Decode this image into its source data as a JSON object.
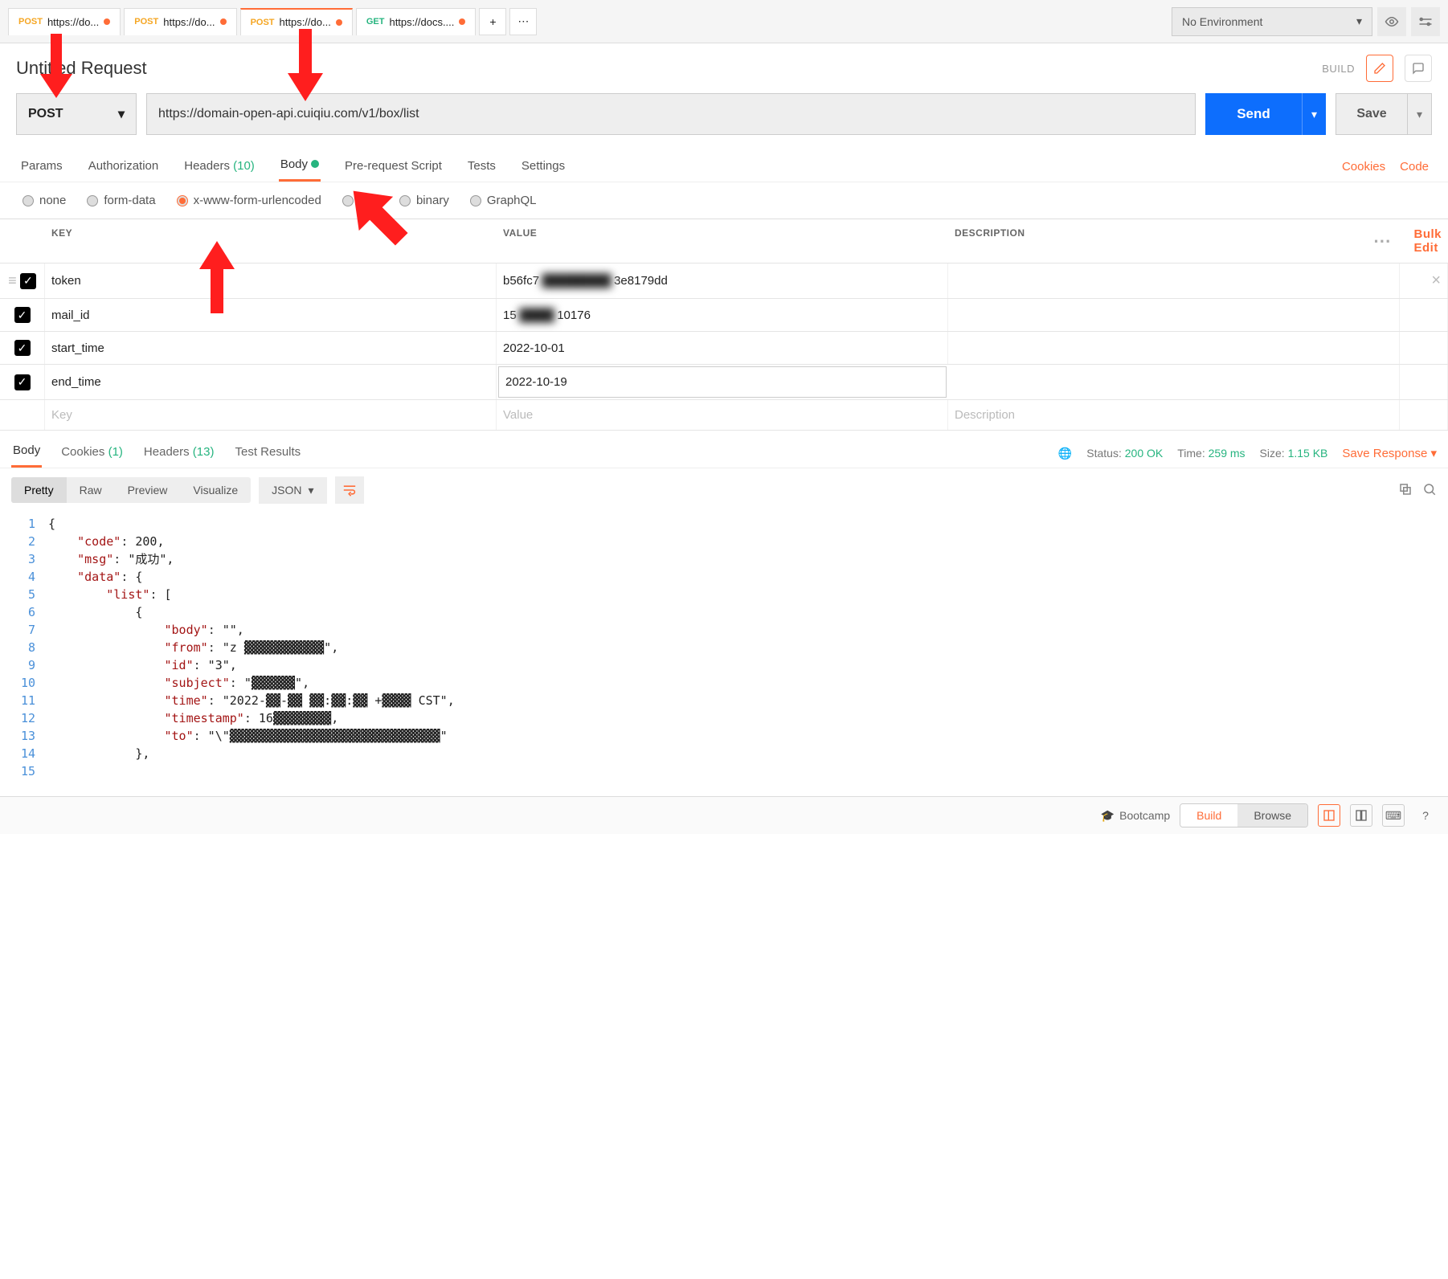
{
  "topbar": {
    "tabs": [
      {
        "method": "POST",
        "label": "https://do...",
        "method_class": "method-post"
      },
      {
        "method": "POST",
        "label": "https://do...",
        "method_class": "method-post"
      },
      {
        "method": "POST",
        "label": "https://do...",
        "method_class": "method-post",
        "active": true
      },
      {
        "method": "GET",
        "label": "https://docs....",
        "method_class": "method-get"
      }
    ],
    "env_label": "No Environment"
  },
  "request": {
    "title": "Untitled Request",
    "build_label": "BUILD",
    "method": "POST",
    "url": "https://domain-open-api.cuiqiu.com/v1/box/list",
    "send": "Send",
    "save": "Save"
  },
  "req_tabs": {
    "params": "Params",
    "auth": "Authorization",
    "headers": "Headers",
    "headers_count": "(10)",
    "body": "Body",
    "prereq": "Pre-request Script",
    "tests": "Tests",
    "settings": "Settings",
    "cookies": "Cookies",
    "code": "Code"
  },
  "body_types": {
    "none": "none",
    "formdata": "form-data",
    "xwww": "x-www-form-urlencoded",
    "raw": "raw",
    "binary": "binary",
    "graphql": "GraphQL"
  },
  "kv": {
    "head_key": "KEY",
    "head_value": "VALUE",
    "head_desc": "DESCRIPTION",
    "bulk": "Bulk Edit",
    "ph_key": "Key",
    "ph_value": "Value",
    "ph_desc": "Description",
    "rows": [
      {
        "key": "token",
        "value_pre": "b56fc7",
        "value_post": "3e8179dd",
        "has_blur": true
      },
      {
        "key": "mail_id",
        "value_pre": "15",
        "value_post": "10176",
        "has_blur": true
      },
      {
        "key": "start_time",
        "value": "2022-10-01"
      },
      {
        "key": "end_time",
        "value": "2022-10-19"
      }
    ]
  },
  "resp_tabs": {
    "body": "Body",
    "cookies": "Cookies",
    "cookies_count": "(1)",
    "headers": "Headers",
    "headers_count": "(13)",
    "testres": "Test Results",
    "status_label": "Status:",
    "status_value": "200 OK",
    "time_label": "Time:",
    "time_value": "259 ms",
    "size_label": "Size:",
    "size_value": "1.15 KB",
    "save_resp": "Save Response"
  },
  "view": {
    "pretty": "Pretty",
    "raw": "Raw",
    "preview": "Preview",
    "visualize": "Visualize",
    "json": "JSON"
  },
  "code_lines": [
    "{",
    "    \"code\": 200,",
    "    \"msg\": \"成功\",",
    "    \"data\": {",
    "        \"list\": [",
    "            {",
    "                \"body\": \"\",",
    "                \"from\": \"z ▓▓▓▓▓▓▓▓▓▓▓\",",
    "                \"id\": \"3\",",
    "                \"subject\": \"▓▓▓▓▓▓\",",
    "                \"time\": \"2022-▓▓-▓▓ ▓▓:▓▓:▓▓ +▓▓▓▓ CST\",",
    "                \"timestamp\": 16▓▓▓▓▓▓▓▓,",
    "                \"to\": \"\\\"▓▓▓▓▓▓▓▓▓▓▓▓▓▓▓▓▓▓▓▓▓▓▓▓▓▓▓▓▓\"",
    "            },",
    ""
  ],
  "footer": {
    "bootcamp": "Bootcamp",
    "build": "Build",
    "browse": "Browse"
  }
}
